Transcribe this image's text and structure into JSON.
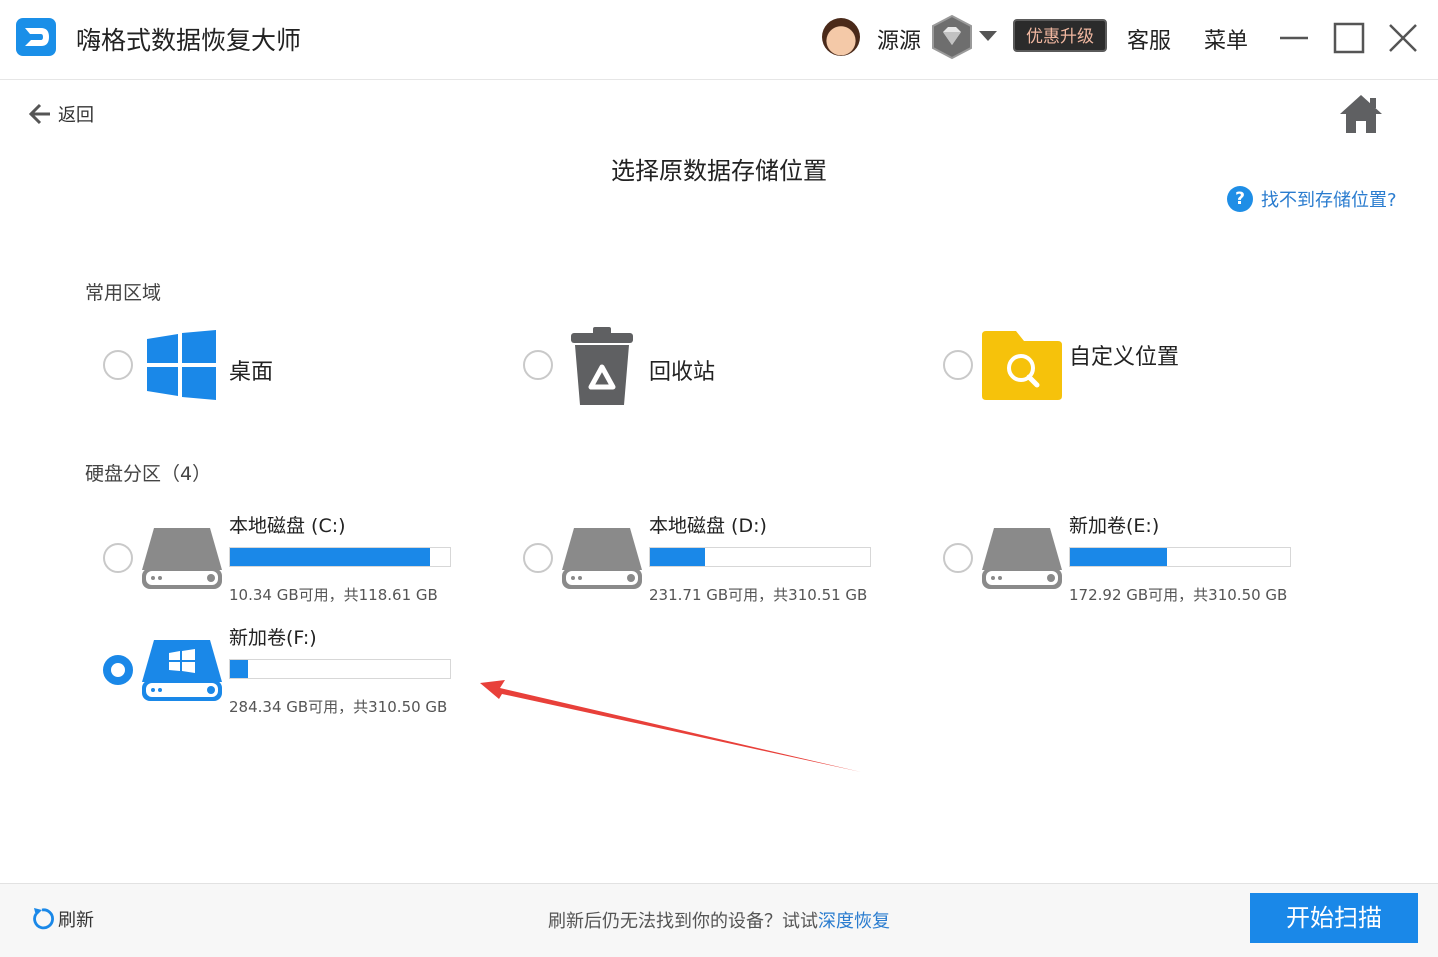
{
  "app": {
    "title": "嗨格式数据恢复大师",
    "brand_color": "#1a88e8"
  },
  "header": {
    "username": "源源",
    "upgrade_label": "优惠升级",
    "service_label": "客服",
    "menu_label": "菜单"
  },
  "nav": {
    "back_label": "返回",
    "refresh_label": "刷新"
  },
  "page": {
    "title": "选择原数据存储位置",
    "help_text": "找不到存储位置?",
    "help_icon": "?"
  },
  "common": {
    "title": "常用区域",
    "items": [
      {
        "label": "桌面",
        "icon": "windows-icon"
      },
      {
        "label": "回收站",
        "icon": "recycle-bin-icon"
      },
      {
        "label": "自定义位置",
        "icon": "folder-search-icon"
      }
    ]
  },
  "disks": {
    "title": "硬盘分区（4）",
    "items": [
      {
        "name": "本地磁盘 (C:)",
        "info": "10.34 GB可用，共118.61 GB",
        "used_fraction": 0.91,
        "selected": false
      },
      {
        "name": "本地磁盘 (D:)",
        "info": "231.71 GB可用，共310.51 GB",
        "used_fraction": 0.25,
        "selected": false
      },
      {
        "name": "新加卷(E:)",
        "info": "172.92 GB可用，共310.50 GB",
        "used_fraction": 0.44,
        "selected": false
      },
      {
        "name": "新加卷(F:)",
        "info": "284.34 GB可用，共310.50 GB",
        "used_fraction": 0.08,
        "selected": true
      }
    ]
  },
  "footer": {
    "message": "刷新后仍无法找到你的设备？试试",
    "link_text": "深度恢复",
    "start_label": "开始扫描"
  }
}
